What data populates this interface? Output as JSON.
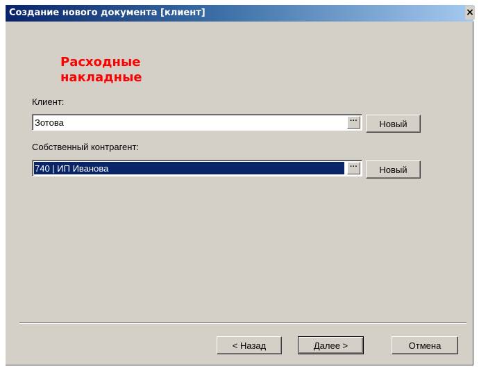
{
  "window": {
    "title": "Создание нового документа [клиент]",
    "close_glyph": "×"
  },
  "heading": {
    "line1": "Расходные",
    "line2": "накладные"
  },
  "client": {
    "label": "Клиент:",
    "value": "Зотова",
    "browse_glyph": "···",
    "new_label": "Новый"
  },
  "counterparty": {
    "label": "Собственный контрагент:",
    "value": "740 | ИП Иванова",
    "browse_glyph": "···",
    "new_label": "Новый"
  },
  "buttons": {
    "back": "< Назад",
    "next": "Далее >",
    "cancel": "Отмена"
  },
  "colors": {
    "heading": "#ff0000",
    "titlebar_start": "#0a246a",
    "titlebar_end": "#a6caf0",
    "selection": "#0a246a",
    "dialog_bg": "#d4d0c8"
  },
  "icons": {
    "close": "close-icon",
    "browse": "ellipsis-icon"
  }
}
